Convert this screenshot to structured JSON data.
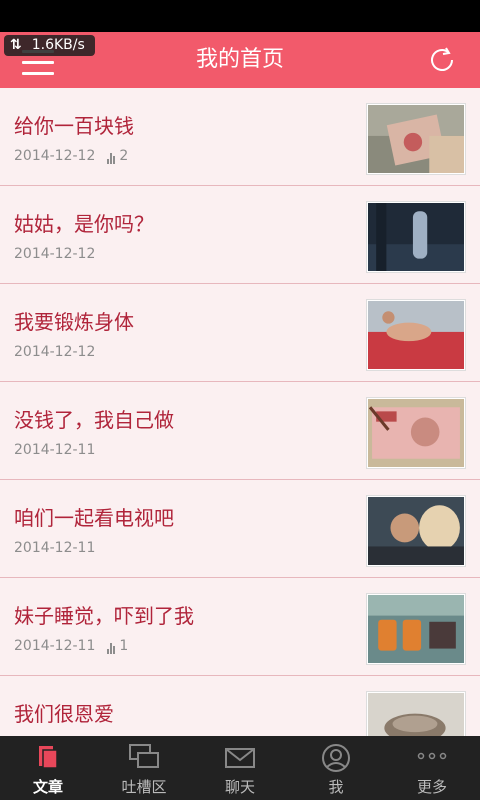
{
  "status": {
    "network_speed": "1.6KB/s"
  },
  "header": {
    "title": "我的首页"
  },
  "articles": [
    {
      "title": "给你一百块钱",
      "date": "2014-12-12",
      "count": "2"
    },
    {
      "title": "姑姑，是你吗？",
      "date": "2014-12-12",
      "count": ""
    },
    {
      "title": "我要锻炼身体",
      "date": "2014-12-12",
      "count": ""
    },
    {
      "title": "没钱了，我自己做",
      "date": "2014-12-11",
      "count": ""
    },
    {
      "title": "咱们一起看电视吧",
      "date": "2014-12-11",
      "count": ""
    },
    {
      "title": "妹子睡觉，吓到了我",
      "date": "2014-12-11",
      "count": "1"
    },
    {
      "title": "我们很恩爱",
      "date": "",
      "count": ""
    }
  ],
  "tabs": [
    {
      "label": "文章",
      "icon": "article-icon",
      "active": true
    },
    {
      "label": "吐槽区",
      "icon": "chat-bubbles-icon",
      "active": false
    },
    {
      "label": "聊天",
      "icon": "envelope-icon",
      "active": false
    },
    {
      "label": "我",
      "icon": "user-icon",
      "active": false
    },
    {
      "label": "更多",
      "icon": "more-dots-icon",
      "active": false
    }
  ],
  "colors": {
    "header": "#f25a6b",
    "title_text": "#b0243a",
    "list_bg": "#fbf0f1",
    "tabbar": "#222222",
    "active_tab_icon": "#e8475a"
  }
}
